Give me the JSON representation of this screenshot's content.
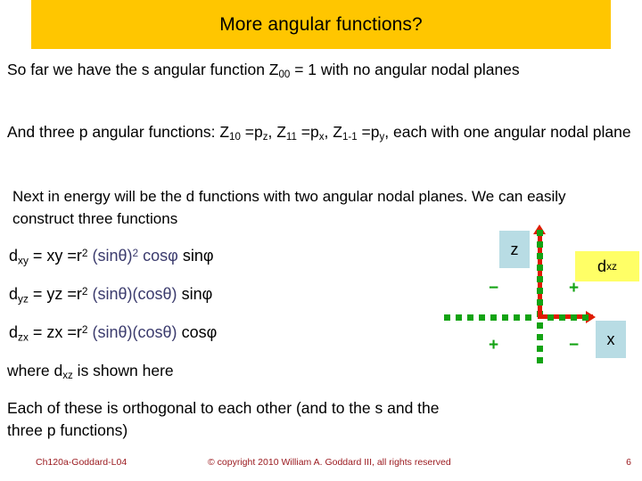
{
  "slide": {
    "title": "More angular functions?",
    "title_bg": "#ffc600",
    "page_number": "6"
  },
  "body": {
    "para_0_a": "So far we have the s angular function Z",
    "para_0_sub": "00",
    "para_0_b": " = 1 with no angular nodal planes",
    "para_1_a": "And three p angular functions: Z",
    "para_1_sub1": "10",
    "para_1_b": " =p",
    "para_1_sub2": "z",
    "para_1_c": ", Z",
    "para_1_sub3": "11",
    "para_1_d": " =p",
    "para_1_sub4": "x",
    "para_1_e": ", Z",
    "para_1_sub5": "1-1",
    "para_1_f": " =p",
    "para_1_sub6": "y",
    "para_1_g": ", each with one angular nodal plane",
    "para_2": "Next in energy will be the d functions with two angular nodal planes. We can easily construct three functions",
    "para_where_a": "where d",
    "para_where_sub": "xz",
    "para_where_b": " is shown here",
    "para_ortho": "Each of these is orthogonal to each other (and to the s and the three p functions)"
  },
  "formulas": [
    {
      "lead": "d",
      "sub": "xy",
      "mid": " = xy =r",
      "exp": "2",
      "trig_a": " (sinθ)",
      "trig_exp": "2",
      "trig_b": " cosφ",
      "tail": " sinφ"
    },
    {
      "lead": "d",
      "sub": "yz",
      "mid": " = yz =r",
      "exp": "2",
      "trig_a": " (sinθ)(cosθ)",
      "trig_exp": "",
      "trig_b": "",
      "tail": " sinφ"
    },
    {
      "lead": "d",
      "sub": "zx",
      "mid": " = zx =r",
      "exp": "2",
      "trig_a": " (sinθ)(cosθ)",
      "trig_exp": "",
      "trig_b": "",
      "tail": " cosφ"
    }
  ],
  "diagram": {
    "z_label": "z",
    "x_label": "x",
    "orbital_lead": "d",
    "orbital_sub": "xz",
    "sign_top_left": "−",
    "sign_top_right": "+",
    "sign_bottom_left": "+",
    "sign_bottom_right": "−",
    "axis_color": "#e01b00",
    "nodal_color": "#13a313",
    "label_bg": "#b8dce4",
    "orbital_bg": "#ffff66"
  },
  "footer": {
    "course": "Ch120a-Goddard-L04",
    "copyright": "© copyright 2010 William A. Goddard III, all rights reserved",
    "color": "#9b1b20"
  }
}
